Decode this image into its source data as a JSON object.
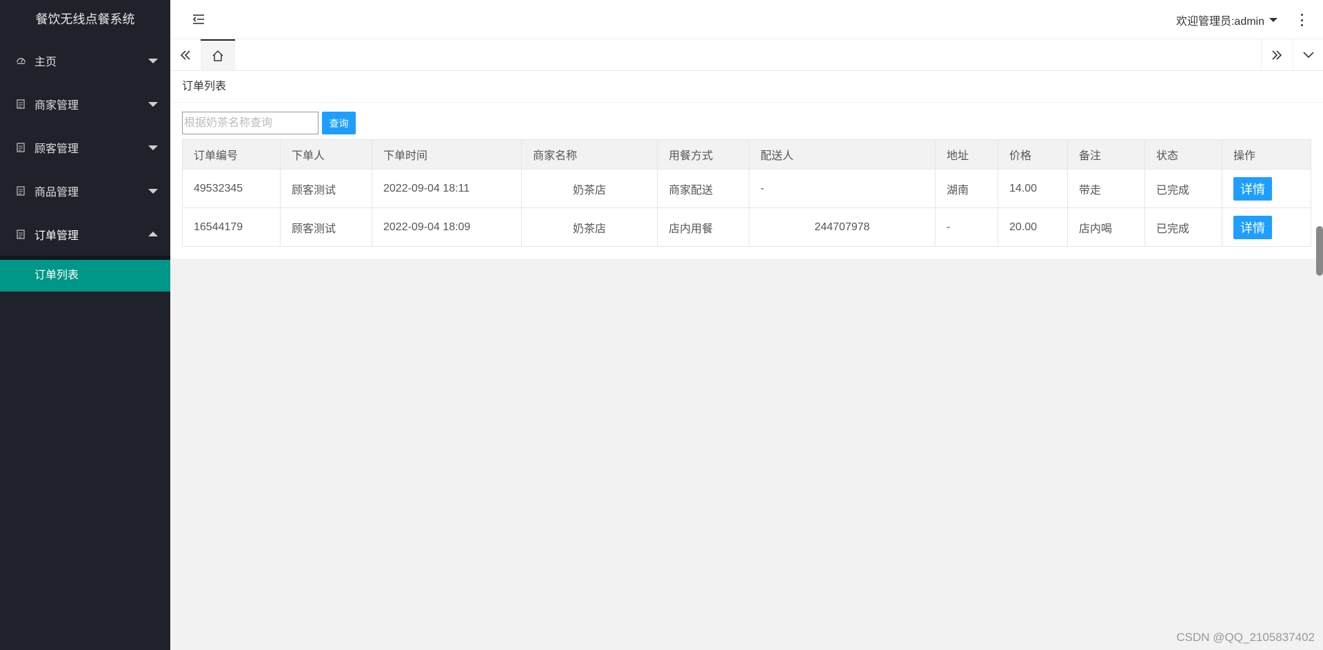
{
  "app": {
    "title": "餐饮无线点餐系统"
  },
  "sidebar": {
    "items": [
      {
        "label": "主页",
        "icon": "dashboard-icon",
        "expanded": false
      },
      {
        "label": "商家管理",
        "icon": "document-icon",
        "expanded": false
      },
      {
        "label": "顾客管理",
        "icon": "document-icon",
        "expanded": false
      },
      {
        "label": "商品管理",
        "icon": "document-icon",
        "expanded": false
      },
      {
        "label": "订单管理",
        "icon": "document-icon",
        "expanded": true
      }
    ],
    "submenu": {
      "active_label": "订单列表"
    }
  },
  "header": {
    "user_label": "欢迎管理员:admin"
  },
  "page": {
    "title": "订单列表"
  },
  "search": {
    "placeholder": "根据奶茶名称查询",
    "value": "",
    "button_label": "查询"
  },
  "table": {
    "columns": [
      "订单编号",
      "下单人",
      "下单时间",
      "商家名称",
      "用餐方式",
      "配送人",
      "地址",
      "价格",
      "备注",
      "状态",
      "操作"
    ],
    "rows": [
      {
        "order_id": "49532345",
        "customer": "顾客测试",
        "time": "2022-09-04 18:11",
        "merchant": "奶茶店",
        "dining": "商家配送",
        "courier": "-",
        "address": "湖南",
        "price": "14.00",
        "note": "带走",
        "status": "已完成",
        "action": "详情"
      },
      {
        "order_id": "16544179",
        "customer": "顾客测试",
        "time": "2022-09-04 18:09",
        "merchant": "奶茶店",
        "dining": "店内用餐",
        "courier": "244707978",
        "address": "-",
        "price": "20.00",
        "note": "店内喝",
        "status": "已完成",
        "action": "详情"
      }
    ]
  },
  "colors": {
    "sidebar_bg": "#1f222a",
    "accent": "#009688",
    "button": "#1e9fff"
  },
  "watermark": "CSDN @QQ_2105837402"
}
